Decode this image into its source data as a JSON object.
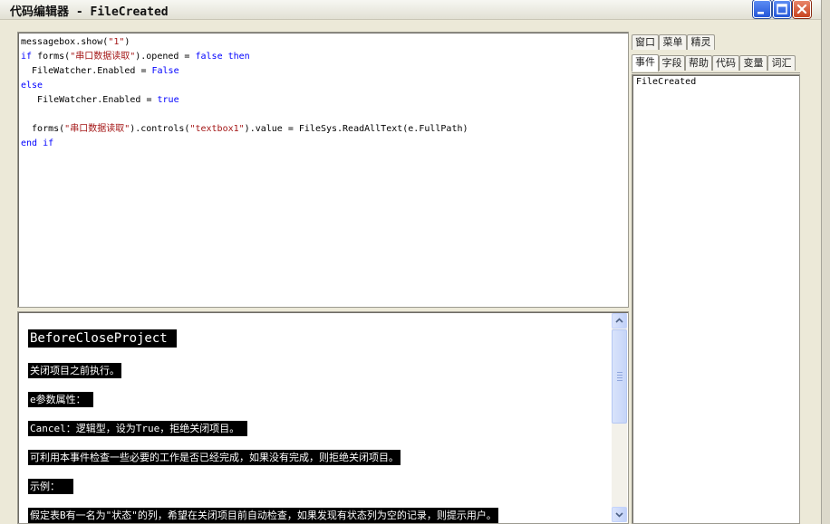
{
  "window": {
    "app_name": "代码编辑器",
    "separator": " - ",
    "event_name": "FileCreated"
  },
  "editor": {
    "lines": [
      [
        {
          "t": "messagebox.show(",
          "c": ""
        },
        {
          "t": "\"1\"",
          "c": "str"
        },
        {
          "t": ")",
          "c": ""
        }
      ],
      [
        {
          "t": "if",
          "c": "kw"
        },
        {
          "t": " forms(",
          "c": ""
        },
        {
          "t": "\"串口数据读取\"",
          "c": "str"
        },
        {
          "t": ").opened = ",
          "c": ""
        },
        {
          "t": "false",
          "c": "kw"
        },
        {
          "t": " ",
          "c": ""
        },
        {
          "t": "then",
          "c": "kw"
        }
      ],
      [
        {
          "t": "  FileWatcher.Enabled = ",
          "c": ""
        },
        {
          "t": "False",
          "c": "kw"
        }
      ],
      [
        {
          "t": "else",
          "c": "kw"
        }
      ],
      [
        {
          "t": "   FileWatcher.Enabled = ",
          "c": ""
        },
        {
          "t": "true",
          "c": "kw"
        }
      ],
      [
        {
          "t": "",
          "c": ""
        }
      ],
      [
        {
          "t": "  forms(",
          "c": ""
        },
        {
          "t": "\"串口数据读取\"",
          "c": "str"
        },
        {
          "t": ").controls(",
          "c": ""
        },
        {
          "t": "\"textbox1\"",
          "c": "str"
        },
        {
          "t": ").value = FileSys.ReadAllText(e.FullPath)",
          "c": ""
        }
      ],
      [
        {
          "t": "end if",
          "c": "kw"
        }
      ]
    ]
  },
  "help": {
    "heading": "BeforeCloseProject ",
    "paragraphs": [
      "关闭项目之前执行。",
      "e参数属性： ",
      "Cancel：逻辑型，设为True，拒绝关闭项目。 ",
      "可利用本事件检查一些必要的工作是否已经完成，如果没有完成，则拒绝关闭项目。",
      "示例：  ",
      "假定表B有一名为\"状态\"的列，希望在关闭项目前自动检查，如果发现有状态列为空的记录，则提示用户。"
    ]
  },
  "tabs": {
    "row1": [
      "窗口",
      "菜单",
      "精灵"
    ],
    "row2": [
      "事件",
      "字段",
      "帮助",
      "代码",
      "变量",
      "词汇"
    ],
    "active": "事件"
  },
  "events_panel": {
    "items": [
      "FileCreated"
    ]
  },
  "colors": {
    "keyword": "#0000ff",
    "string": "#a31515",
    "help_highlight_bg": "#000000",
    "window_bg": "#ece9d8"
  },
  "icons": {
    "minimize": "minimize-icon",
    "maximize": "maximize-icon",
    "close": "close-icon",
    "scroll_up": "chevron-up-icon",
    "scroll_down": "chevron-down-icon"
  }
}
